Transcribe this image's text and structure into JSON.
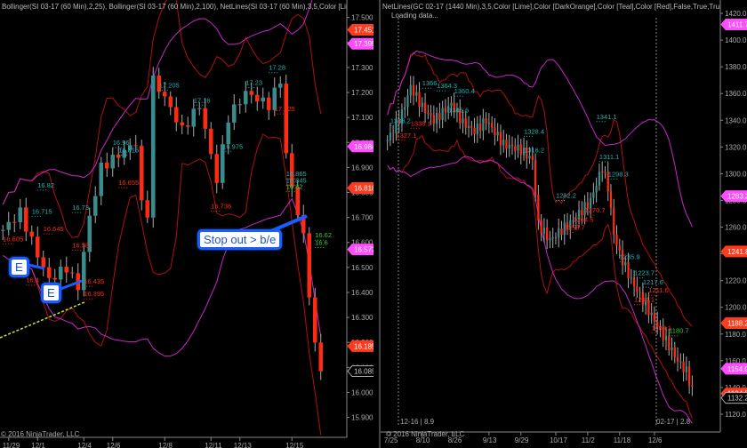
{
  "left_chart": {
    "header": "Bollinger(SI 03-17 (60 Min),2,25), Bollinger(SI 03-17 (60 Min),2,100), NetLines(SI 03-17 (60 Min),3,5,Color [Lime],Color [DarkOrange],Color [Teal],Color [Red],False,True,True)",
    "copyright": "© 2016 NinjaTrader, LLC",
    "y_ticks": [
      "17.500",
      "17.400",
      "17.300",
      "17.200",
      "17.100",
      "17.000",
      "16.900",
      "16.800",
      "16.700",
      "16.600",
      "16.500",
      "16.400",
      "16.300",
      "16.200",
      "16.100",
      "16.000",
      "15.900"
    ],
    "y_range": [
      15.87,
      17.57
    ],
    "x_labels": [
      {
        "t": "11/29",
        "i": 1
      },
      {
        "t": "12/1",
        "i": 6
      },
      {
        "t": "12/4",
        "i": 14
      },
      {
        "t": "12/6",
        "i": 19
      },
      {
        "t": "12/8",
        "i": 28
      },
      {
        "t": "12/11",
        "i": 36
      },
      {
        "t": "12/13",
        "i": 41
      },
      {
        "t": "12/15",
        "i": 50
      }
    ],
    "bars": 56,
    "path": [
      [
        0,
        16.65
      ],
      [
        3,
        16.72
      ],
      [
        6,
        16.55
      ],
      [
        8,
        16.45
      ],
      [
        11,
        16.5
      ],
      [
        13,
        16.42
      ],
      [
        15,
        16.7
      ],
      [
        17,
        16.9
      ],
      [
        20,
        16.95
      ],
      [
        23,
        17.0
      ],
      [
        24,
        16.75
      ],
      [
        25,
        16.72
      ],
      [
        26,
        17.25
      ],
      [
        28,
        17.18
      ],
      [
        31,
        17.05
      ],
      [
        34,
        17.15
      ],
      [
        37,
        16.85
      ],
      [
        39,
        17.1
      ],
      [
        42,
        17.2
      ],
      [
        46,
        17.15
      ],
      [
        48,
        17.25
      ],
      [
        49,
        16.95
      ],
      [
        50,
        16.82
      ],
      [
        52,
        16.62
      ],
      [
        54,
        16.18
      ],
      [
        55,
        16.1
      ]
    ],
    "price_markers": [
      {
        "text": "17.451",
        "color": "#ff3b1f",
        "price": 17.451
      },
      {
        "text": "17.395",
        "color": "#ff4cff",
        "price": 17.395
      },
      {
        "text": "16.984",
        "color": "#ff4cff",
        "price": 16.984
      },
      {
        "text": "16.818",
        "color": "#ff3b1f",
        "price": 16.818
      },
      {
        "text": "16.572",
        "color": "#ff4cff",
        "price": 16.572
      },
      {
        "text": "16.185",
        "color": "#ff3b1f",
        "price": 16.185
      },
      {
        "text": "16.085",
        "color": "outline",
        "price": 16.085
      }
    ],
    "level_labels": [
      {
        "text": "16.82",
        "i": 6,
        "price": 16.82,
        "c": "teal"
      },
      {
        "text": "16.715",
        "i": 5,
        "price": 16.715,
        "c": "teal"
      },
      {
        "text": "16.645",
        "i": 7,
        "price": 16.645,
        "c": "red"
      },
      {
        "text": "16.605",
        "i": 0,
        "price": 16.605,
        "c": "red"
      },
      {
        "text": "16.58",
        "i": 12,
        "price": 16.58,
        "c": "red"
      },
      {
        "text": "16.4",
        "i": 4,
        "price": 16.44,
        "c": "red"
      },
      {
        "text": "16.435",
        "i": 14,
        "price": 16.435,
        "c": "red"
      },
      {
        "text": "16.395",
        "i": 14,
        "price": 16.385,
        "c": "red"
      },
      {
        "text": "16.73",
        "i": 12,
        "price": 16.73,
        "c": "teal"
      },
      {
        "text": "16.655",
        "i": 20,
        "price": 16.83,
        "c": "red"
      },
      {
        "text": "16.815",
        "i": 20,
        "price": 16.96,
        "c": "teal"
      },
      {
        "text": "16.96",
        "i": 19,
        "price": 16.99,
        "c": "teal"
      },
      {
        "text": "17.205",
        "i": 27,
        "price": 17.22,
        "c": "teal"
      },
      {
        "text": "17.16",
        "i": 33,
        "price": 17.16,
        "c": "teal"
      },
      {
        "text": "17.125",
        "i": 47,
        "price": 17.125,
        "c": "red"
      },
      {
        "text": "17.23",
        "i": 42,
        "price": 17.23,
        "c": "teal"
      },
      {
        "text": "16.736",
        "i": 36,
        "price": 16.736,
        "c": "red"
      },
      {
        "text": "16.975",
        "i": 38,
        "price": 16.975,
        "c": "teal"
      },
      {
        "text": "16.865",
        "i": 49,
        "price": 16.865,
        "c": "teal"
      },
      {
        "text": "16.845",
        "i": 49,
        "price": 16.84,
        "c": "teal"
      },
      {
        "text": "16.82",
        "i": 49,
        "price": 16.815,
        "c": "lime"
      },
      {
        "text": "16.62",
        "i": 54,
        "price": 16.62,
        "c": "lime"
      },
      {
        "text": "16.6",
        "i": 54,
        "price": 16.59,
        "c": "lime"
      },
      {
        "text": "17.28",
        "i": 46,
        "price": 17.29,
        "c": "teal"
      }
    ],
    "callouts": [
      {
        "text": "E"
      },
      {
        "text": "E"
      },
      {
        "text": "Stop out > b/e"
      }
    ]
  },
  "right_chart": {
    "header": "NetLines(GC 02-17 (1440 Min),3,5,Color [Lime],Color [DarkOrange],Color [Teal],Color [Red],False,True,True), Bollinger",
    "loading": "Loading data...",
    "copyright": "© 2016 NinjaTrader, LLC",
    "session_left": "12-16 | 8.9",
    "session_right": "02-17 | 2.8",
    "y_ticks": [
      "1420.0",
      "1400.0",
      "1380.0",
      "1360.0",
      "1340.0",
      "1320.0",
      "1300.0",
      "1280.0",
      "1260.0",
      "1240.0",
      "1220.0",
      "1200.0",
      "1180.0",
      "1160.0",
      "1140.0",
      "1120.0"
    ],
    "y_range": [
      1116,
      1430
    ],
    "x_labels": [
      {
        "t": "7/25",
        "i": 1
      },
      {
        "t": "8/10",
        "i": 12
      },
      {
        "t": "8/26",
        "i": 23
      },
      {
        "t": "9/13",
        "i": 35
      },
      {
        "t": "9/29",
        "i": 46
      },
      {
        "t": "10/17",
        "i": 58
      },
      {
        "t": "11/2",
        "i": 69
      },
      {
        "t": "11/18",
        "i": 80
      },
      {
        "t": "12/6",
        "i": 92
      }
    ],
    "bars": 106,
    "path": [
      [
        0,
        1325
      ],
      [
        5,
        1345
      ],
      [
        8,
        1365
      ],
      [
        12,
        1350
      ],
      [
        16,
        1340
      ],
      [
        22,
        1352
      ],
      [
        26,
        1338
      ],
      [
        30,
        1332
      ],
      [
        34,
        1340
      ],
      [
        40,
        1322
      ],
      [
        46,
        1318
      ],
      [
        50,
        1310
      ],
      [
        52,
        1262
      ],
      [
        56,
        1250
      ],
      [
        60,
        1258
      ],
      [
        64,
        1265
      ],
      [
        70,
        1280
      ],
      [
        74,
        1305
      ],
      [
        76,
        1290
      ],
      [
        78,
        1255
      ],
      [
        80,
        1240
      ],
      [
        84,
        1220
      ],
      [
        88,
        1205
      ],
      [
        92,
        1190
      ],
      [
        96,
        1175
      ],
      [
        100,
        1160
      ],
      [
        103,
        1152
      ],
      [
        105,
        1138
      ]
    ],
    "price_markers": [
      {
        "text": "1411.7",
        "color": "#ff4cff",
        "price": 1411.7
      },
      {
        "text": "1283.2",
        "color": "#ff4cff",
        "price": 1283.2
      },
      {
        "text": "1241.8",
        "color": "#ff3b1f",
        "price": 1241.8
      },
      {
        "text": "1188.2",
        "color": "#ff3b1f",
        "price": 1188.2
      },
      {
        "text": "1154.0",
        "color": "#ff4cff",
        "price": 1154.0
      },
      {
        "text": "1134.5",
        "color": "#ff3b1f",
        "price": 1135.5
      },
      {
        "text": "1132.2",
        "color": "outline",
        "price": 1132.2
      }
    ],
    "level_labels": [
      {
        "text": "1338.2",
        "i": 1,
        "price": 1338,
        "c": "teal"
      },
      {
        "text": "1327.1",
        "i": 3,
        "price": 1327,
        "c": "red"
      },
      {
        "text": "1366",
        "i": 12,
        "price": 1366,
        "c": "teal"
      },
      {
        "text": "1364.3",
        "i": 17,
        "price": 1364,
        "c": "teal"
      },
      {
        "text": "1338.1",
        "i": 8,
        "price": 1336,
        "c": "red"
      },
      {
        "text": "1360.4",
        "i": 23,
        "price": 1360,
        "c": "teal"
      },
      {
        "text": "1346.6",
        "i": 21,
        "price": 1346,
        "c": "teal"
      },
      {
        "text": "1341.1",
        "i": 72,
        "price": 1341,
        "c": "teal"
      },
      {
        "text": "1328.4",
        "i": 47,
        "price": 1330,
        "c": "teal"
      },
      {
        "text": "1316.2",
        "i": 47,
        "price": 1316,
        "c": "teal"
      },
      {
        "text": "1311.1",
        "i": 73,
        "price": 1311,
        "c": "teal"
      },
      {
        "text": "1298.3",
        "i": 76,
        "price": 1298,
        "c": "teal"
      },
      {
        "text": "1282.2",
        "i": 58,
        "price": 1282,
        "c": "teal"
      },
      {
        "text": "1264.5",
        "i": 64,
        "price": 1264,
        "c": "red"
      },
      {
        "text": "1258.7",
        "i": 61,
        "price": 1258,
        "c": "red"
      },
      {
        "text": "1270.7",
        "i": 68,
        "price": 1271,
        "c": "red"
      },
      {
        "text": "1235.9",
        "i": 80,
        "price": 1236,
        "c": "teal"
      },
      {
        "text": "1223.7",
        "i": 85,
        "price": 1224,
        "c": "teal"
      },
      {
        "text": "1204.1",
        "i": 85,
        "price": 1204,
        "c": "red"
      },
      {
        "text": "1217.6",
        "i": 88,
        "price": 1217,
        "c": "teal"
      },
      {
        "text": "1180.7",
        "i": 97,
        "price": 1180.7,
        "c": "lime"
      },
      {
        "text": "1183.1",
        "i": 91,
        "price": 1183,
        "c": "red"
      },
      {
        "text": "1211.6",
        "i": 90,
        "price": 1211,
        "c": "red"
      }
    ]
  },
  "colors": {
    "bull": "#3a8c8c",
    "bear": "#ff2a12",
    "wick": "#aaaaaa",
    "bb_short": "#b01010",
    "bb_long": "#c828c8",
    "teal": "#1fb3b3",
    "red": "#ff2a12",
    "lime": "#2ecc2e",
    "callout_border": "#1a5cff"
  }
}
